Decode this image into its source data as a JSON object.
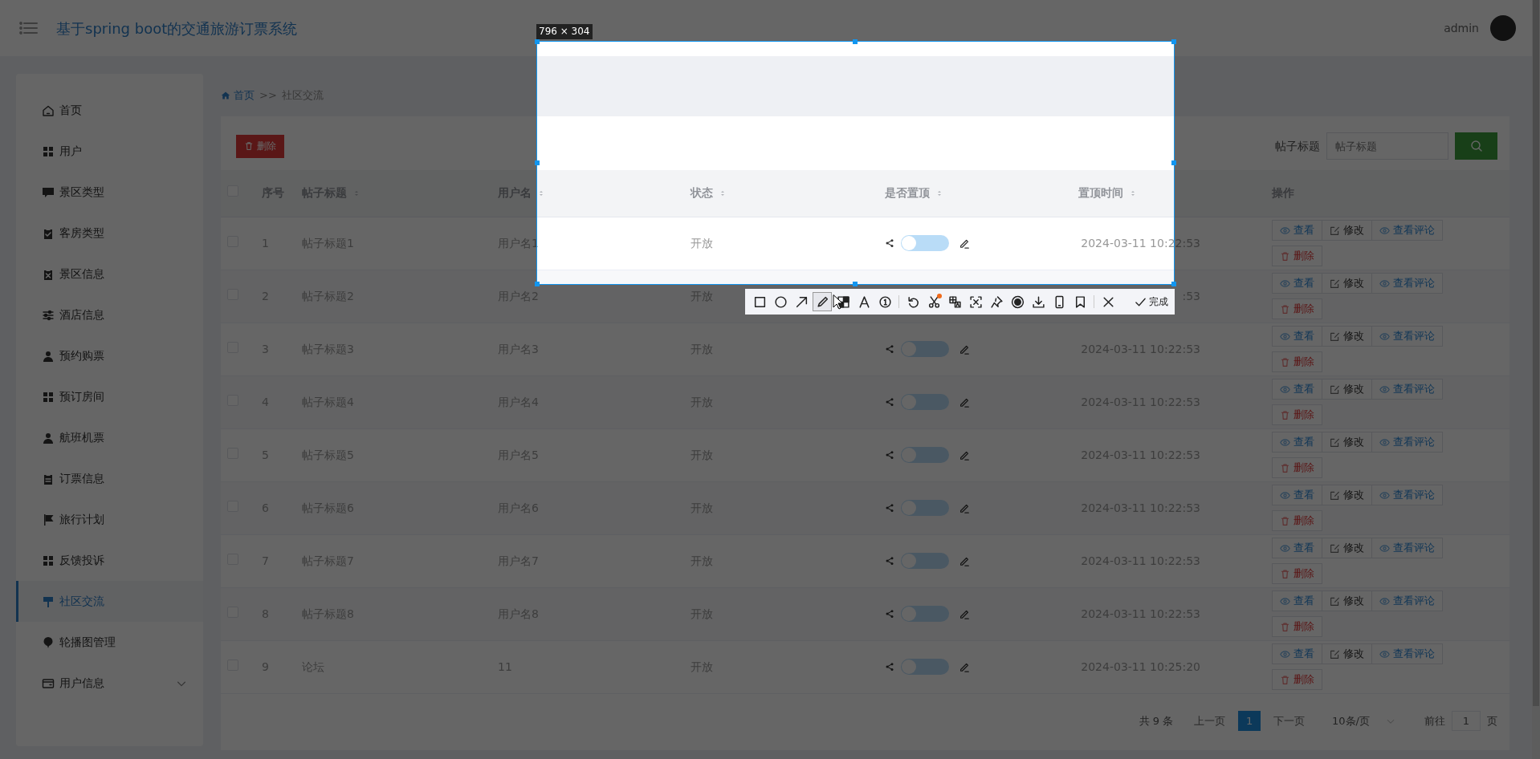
{
  "header": {
    "title": "基于spring boot的交通旅游订票系统",
    "user": "admin"
  },
  "sidebar": {
    "items": [
      {
        "label": "首页",
        "kind": "link",
        "selected": false
      },
      {
        "label": "用户",
        "kind": "link",
        "selected": false
      },
      {
        "label": "景区类型",
        "kind": "link",
        "selected": false
      },
      {
        "label": "客房类型",
        "kind": "link",
        "selected": false
      },
      {
        "label": "景区信息",
        "kind": "link",
        "selected": false
      },
      {
        "label": "酒店信息",
        "kind": "link",
        "selected": false
      },
      {
        "label": "预约购票",
        "kind": "link",
        "selected": false
      },
      {
        "label": "预订房间",
        "kind": "link",
        "selected": false
      },
      {
        "label": "航班机票",
        "kind": "link",
        "selected": false
      },
      {
        "label": "订票信息",
        "kind": "link",
        "selected": false
      },
      {
        "label": "旅行计划",
        "kind": "link",
        "selected": false
      },
      {
        "label": "反馈投诉",
        "kind": "link",
        "selected": false
      },
      {
        "label": "社区交流",
        "kind": "link",
        "selected": true
      },
      {
        "label": "轮播图管理",
        "kind": "link",
        "selected": false
      },
      {
        "label": "用户信息",
        "kind": "group",
        "selected": false,
        "expanded": false
      }
    ]
  },
  "breadcrumb": {
    "items": [
      "首页",
      "社区交流"
    ],
    "separator": ">>"
  },
  "toolbar": {
    "delete_button": "删除",
    "search_label": "帖子标题",
    "search": {
      "placeholder": "帖子标题"
    }
  },
  "table": {
    "select_all": {
      "checked": false
    },
    "columns": [
      {
        "label": "序号",
        "sortable": false
      },
      {
        "label": "帖子标题",
        "sortable": true
      },
      {
        "label": "用户名",
        "sortable": true
      },
      {
        "label": "状态",
        "sortable": true
      },
      {
        "label": "是否置顶",
        "sortable": true
      },
      {
        "label": "置顶时间",
        "sortable": true
      },
      {
        "label": "操作",
        "sortable": false
      }
    ],
    "rows": [
      {
        "checked": false,
        "index": "1",
        "title": "帖子标题1",
        "username": "用户名1",
        "status": "开放",
        "pinned": false,
        "pin_time": "2024-03-11 10:22:53",
        "actions": [
          {
            "kind": "view",
            "label": "查看"
          },
          {
            "kind": "edit",
            "label": "修改"
          },
          {
            "kind": "comments",
            "label": "查看评论"
          },
          {
            "kind": "delete",
            "label": "删除"
          }
        ]
      },
      {
        "checked": false,
        "index": "2",
        "title": "帖子标题2",
        "username": "用户名2",
        "status": "开放",
        "pin_time": ":53",
        "actions": [
          {
            "kind": "view",
            "label": "查看"
          },
          {
            "kind": "edit",
            "label": "修改"
          },
          {
            "kind": "comments",
            "label": "查看评论"
          },
          {
            "kind": "delete",
            "label": "删除"
          }
        ]
      },
      {
        "checked": false,
        "index": "3",
        "title": "帖子标题3",
        "username": "用户名3",
        "status": "开放",
        "pinned": false,
        "pin_time": "2024-03-11 10:22:53",
        "actions": [
          {
            "kind": "view",
            "label": "查看"
          },
          {
            "kind": "edit",
            "label": "修改"
          },
          {
            "kind": "comments",
            "label": "查看评论"
          },
          {
            "kind": "delete",
            "label": "删除"
          }
        ]
      },
      {
        "checked": false,
        "index": "4",
        "title": "帖子标题4",
        "username": "用户名4",
        "status": "开放",
        "pinned": false,
        "pin_time": "2024-03-11 10:22:53",
        "actions": [
          {
            "kind": "view",
            "label": "查看"
          },
          {
            "kind": "edit",
            "label": "修改"
          },
          {
            "kind": "comments",
            "label": "查看评论"
          },
          {
            "kind": "delete",
            "label": "删除"
          }
        ]
      },
      {
        "checked": false,
        "index": "5",
        "title": "帖子标题5",
        "username": "用户名5",
        "status": "开放",
        "pinned": false,
        "pin_time": "2024-03-11 10:22:53",
        "actions": [
          {
            "kind": "view",
            "label": "查看"
          },
          {
            "kind": "edit",
            "label": "修改"
          },
          {
            "kind": "comments",
            "label": "查看评论"
          },
          {
            "kind": "delete",
            "label": "删除"
          }
        ]
      },
      {
        "checked": false,
        "index": "6",
        "title": "帖子标题6",
        "username": "用户名6",
        "status": "开放",
        "pinned": false,
        "pin_time": "2024-03-11 10:22:53",
        "actions": [
          {
            "kind": "view",
            "label": "查看"
          },
          {
            "kind": "edit",
            "label": "修改"
          },
          {
            "kind": "comments",
            "label": "查看评论"
          },
          {
            "kind": "delete",
            "label": "删除"
          }
        ]
      },
      {
        "checked": false,
        "index": "7",
        "title": "帖子标题7",
        "username": "用户名7",
        "status": "开放",
        "pinned": false,
        "pin_time": "2024-03-11 10:22:53",
        "actions": [
          {
            "kind": "view",
            "label": "查看"
          },
          {
            "kind": "edit",
            "label": "修改"
          },
          {
            "kind": "comments",
            "label": "查看评论"
          },
          {
            "kind": "delete",
            "label": "删除"
          }
        ]
      },
      {
        "checked": false,
        "index": "8",
        "title": "帖子标题8",
        "username": "用户名8",
        "status": "开放",
        "pinned": false,
        "pin_time": "2024-03-11 10:22:53",
        "actions": [
          {
            "kind": "view",
            "label": "查看"
          },
          {
            "kind": "edit",
            "label": "修改"
          },
          {
            "kind": "comments",
            "label": "查看评论"
          },
          {
            "kind": "delete",
            "label": "删除"
          }
        ]
      },
      {
        "checked": false,
        "index": "9",
        "title": "论坛",
        "username": "11",
        "status": "开放",
        "pinned": false,
        "pin_time": "2024-03-11 10:25:20",
        "actions": [
          {
            "kind": "view",
            "label": "查看"
          },
          {
            "kind": "edit",
            "label": "修改"
          },
          {
            "kind": "comments",
            "label": "查看评论"
          },
          {
            "kind": "delete",
            "label": "删除"
          }
        ]
      }
    ]
  },
  "pagination": {
    "total": "共 9 条",
    "prev": "上一页",
    "pages": [
      {
        "label": "1",
        "selected": true
      }
    ],
    "next": "下一页",
    "page_size": "10条/页",
    "goto_label": "前往",
    "goto_value": "1",
    "goto_suffix": "页"
  },
  "capture": {
    "size_label": "796 × 304",
    "tools": [
      {
        "kind": "rectangle",
        "selected": false,
        "notified": false
      },
      {
        "kind": "ellipse",
        "selected": false,
        "notified": false
      },
      {
        "kind": "arrow",
        "selected": false,
        "notified": false
      },
      {
        "kind": "pencil",
        "selected": true,
        "notified": false
      },
      {
        "kind": "mosaic",
        "selected": false,
        "notified": false
      },
      {
        "kind": "text",
        "selected": false,
        "notified": false
      },
      {
        "kind": "number",
        "selected": false,
        "notified": false
      },
      {
        "kind": "separator"
      },
      {
        "kind": "undo",
        "selected": false,
        "notified": false
      },
      {
        "kind": "scissors",
        "selected": false,
        "notified": true
      },
      {
        "kind": "translate",
        "selected": false,
        "notified": false
      },
      {
        "kind": "scan",
        "selected": false,
        "notified": false
      },
      {
        "kind": "pin",
        "selected": false,
        "notified": false
      },
      {
        "kind": "record",
        "selected": false,
        "notified": false
      },
      {
        "kind": "download",
        "selected": false,
        "notified": false
      },
      {
        "kind": "phone",
        "selected": false,
        "notified": false
      },
      {
        "kind": "bookmark",
        "selected": false,
        "notified": false
      },
      {
        "kind": "separator"
      },
      {
        "kind": "close",
        "selected": false,
        "notified": false
      }
    ],
    "done": "完成"
  }
}
